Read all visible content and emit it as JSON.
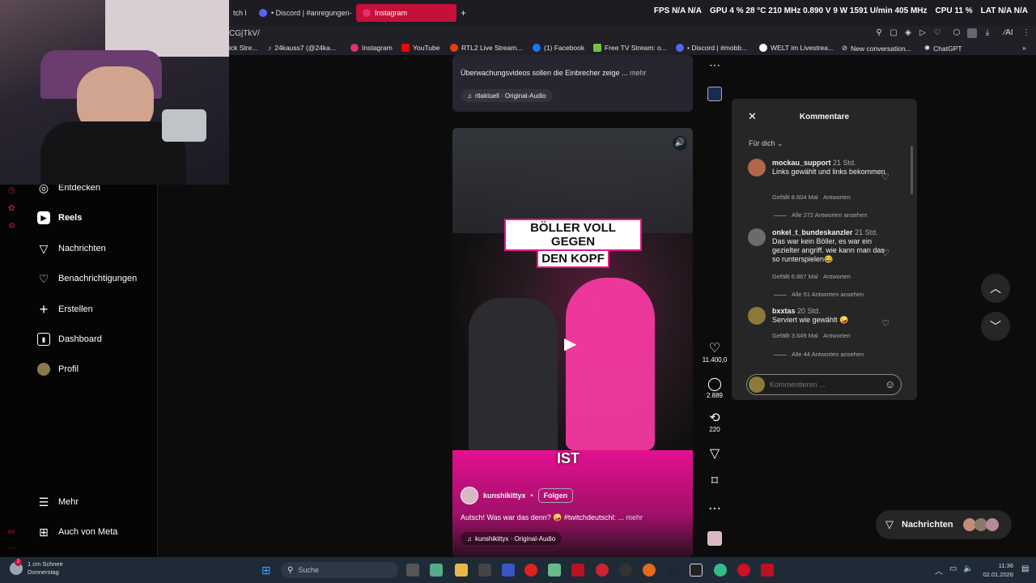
{
  "browser": {
    "tabs": [
      {
        "label": "tch l"
      },
      {
        "label": "• Discord | #anregungen-"
      },
      {
        "label": "Instagram"
      }
    ],
    "new_tab": "+",
    "url": "CGjTkV/",
    "perf": {
      "fps_label": "FPS",
      "fps": "N/A N/A",
      "gpu_label": "GPU",
      "gpu": "4 % 28 °C 210 MHz 0.890 V 9 W 1591 U/min 405 MHz",
      "cpu_label": "CPU",
      "cpu": "11 %",
      "lat_label": "LAT",
      "lat": "N/A N/A"
    },
    "bookmarks": [
      "ick Stre...",
      "24kauss7 (@24ka...",
      "Instagram",
      "YouTube",
      "RTL2 Live Stream...",
      "(1) Facebook",
      "Free TV Stream: o...",
      "• Discord | #mobb...",
      "WELT im Livestrea...",
      "New conversation...",
      "ChatGPT"
    ]
  },
  "sidebar": {
    "items": [
      {
        "label": "Entdecken",
        "icon": "compass-icon"
      },
      {
        "label": "Reels",
        "icon": "reels-icon"
      },
      {
        "label": "Nachrichten",
        "icon": "send-icon"
      },
      {
        "label": "Benachrichtigungen",
        "icon": "heart-icon"
      },
      {
        "label": "Erstellen",
        "icon": "plus-icon"
      },
      {
        "label": "Dashboard",
        "icon": "chart-icon"
      },
      {
        "label": "Profil",
        "icon": "avatar"
      }
    ],
    "bottom": [
      {
        "label": "Mehr",
        "icon": "menu-icon"
      },
      {
        "label": "Auch von Meta",
        "icon": "meta-icon"
      }
    ]
  },
  "prev_post": {
    "caption": "Überwachungsvideos sollen die Einbrecher zeige ...",
    "more": "mehr",
    "audio": "rtlaktuell · Original-Audio"
  },
  "reel": {
    "overlay_top": [
      "BÖLLER VOLL GEGEN",
      "DEN KOPF"
    ],
    "overlay_bottom": "IST",
    "username": "kunshikittyx",
    "separator": "•",
    "follow": "Folgen",
    "caption": "Autsch! Was war das denn? 🤪 #twitchdeutschl: ...",
    "more": "mehr",
    "audio": "kunshikittyx · Original-Audio"
  },
  "actions": {
    "likes": "11.400,0",
    "comments": "2.889",
    "reposts": "220"
  },
  "comments_panel": {
    "title": "Kommentare",
    "filter": "Für dich",
    "input_placeholder": "Kommentieren ...",
    "items": [
      {
        "user": "mockau_support",
        "time": "21 Std.",
        "text": "Links gewählt und links bekommen",
        "likes": "Gefällt 8.604 Mal",
        "reply": "Antworten",
        "replies": "Alle 272 Antworten ansehen"
      },
      {
        "user": "onkel_t_bundeskanzler",
        "time": "21 Std.",
        "text": "Das war kein Böller, es war ein gezielter angriff. wie kann man das so runterspielen😂",
        "likes": "Gefällt 6.867 Mal",
        "reply": "Antworten",
        "replies": "Alle 51 Antworten ansehen"
      },
      {
        "user": "bxxtas",
        "time": "20 Std.",
        "text": "Serviert wie gewählt 🤪",
        "likes": "Gefällt 3.649 Mal",
        "reply": "Antworten",
        "replies": "Alle 44 Antworten ansehen"
      }
    ]
  },
  "messages_pill": {
    "label": "Nachrichten"
  },
  "taskbar": {
    "weather_temp": "1 cm Schnee",
    "weather_day": "Donnerstag",
    "search_placeholder": "Suche",
    "time": "11:36",
    "date": "02.01.2026"
  },
  "colors": {
    "accent": "#c4103a",
    "pink": "#e3118f",
    "panel": "#262626"
  }
}
